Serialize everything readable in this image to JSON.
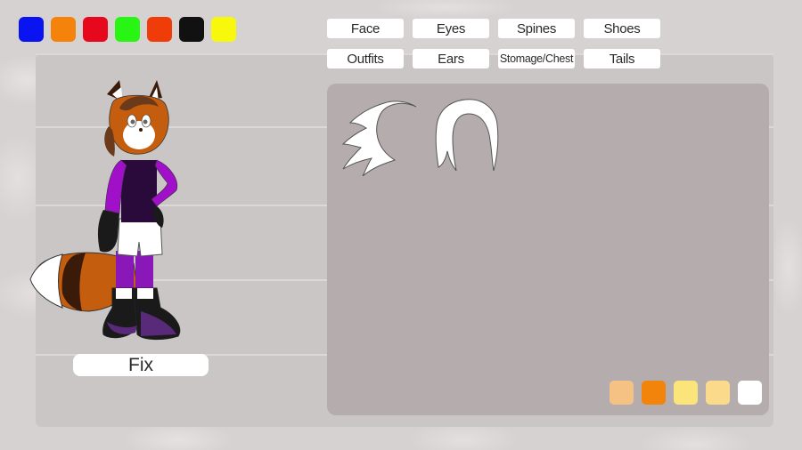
{
  "color_palette": {
    "swatches": [
      {
        "name": "blue",
        "color": "#0a14f0"
      },
      {
        "name": "orange",
        "color": "#f5820a"
      },
      {
        "name": "red",
        "color": "#e8081e"
      },
      {
        "name": "green",
        "color": "#28f514"
      },
      {
        "name": "red-orange",
        "color": "#f03c08"
      },
      {
        "name": "black",
        "color": "#111111"
      },
      {
        "name": "yellow",
        "color": "#f8f80c"
      }
    ]
  },
  "categories": {
    "row1": [
      "Face",
      "Eyes",
      "Spines",
      "Shoes"
    ],
    "row2": [
      "Outfits",
      "Ears",
      "Stomage/Chest",
      "Tails"
    ]
  },
  "options_panel": {
    "items": [
      {
        "name": "spiky-spines",
        "icon": "spiky-hair-icon"
      },
      {
        "name": "bob-hair",
        "icon": "bob-hair-icon"
      }
    ],
    "shade_swatches": [
      {
        "color": "#f6c283"
      },
      {
        "color": "#f3840b"
      },
      {
        "color": "#fbe47a"
      },
      {
        "color": "#fbdb8b"
      },
      {
        "color": "#ffffff"
      }
    ]
  },
  "character": {
    "name": "Fix",
    "colors": {
      "fur": "#c45e0e",
      "hair": "#6b3a1a",
      "hoodie": "#a010c8",
      "shirt": "#2a0a3a",
      "shorts": "#ffffff",
      "socks": "#8a18b8",
      "shoes": "#5a2a7a",
      "gloves": "#1a1a1a",
      "tail_band": "#3a1a08"
    }
  }
}
